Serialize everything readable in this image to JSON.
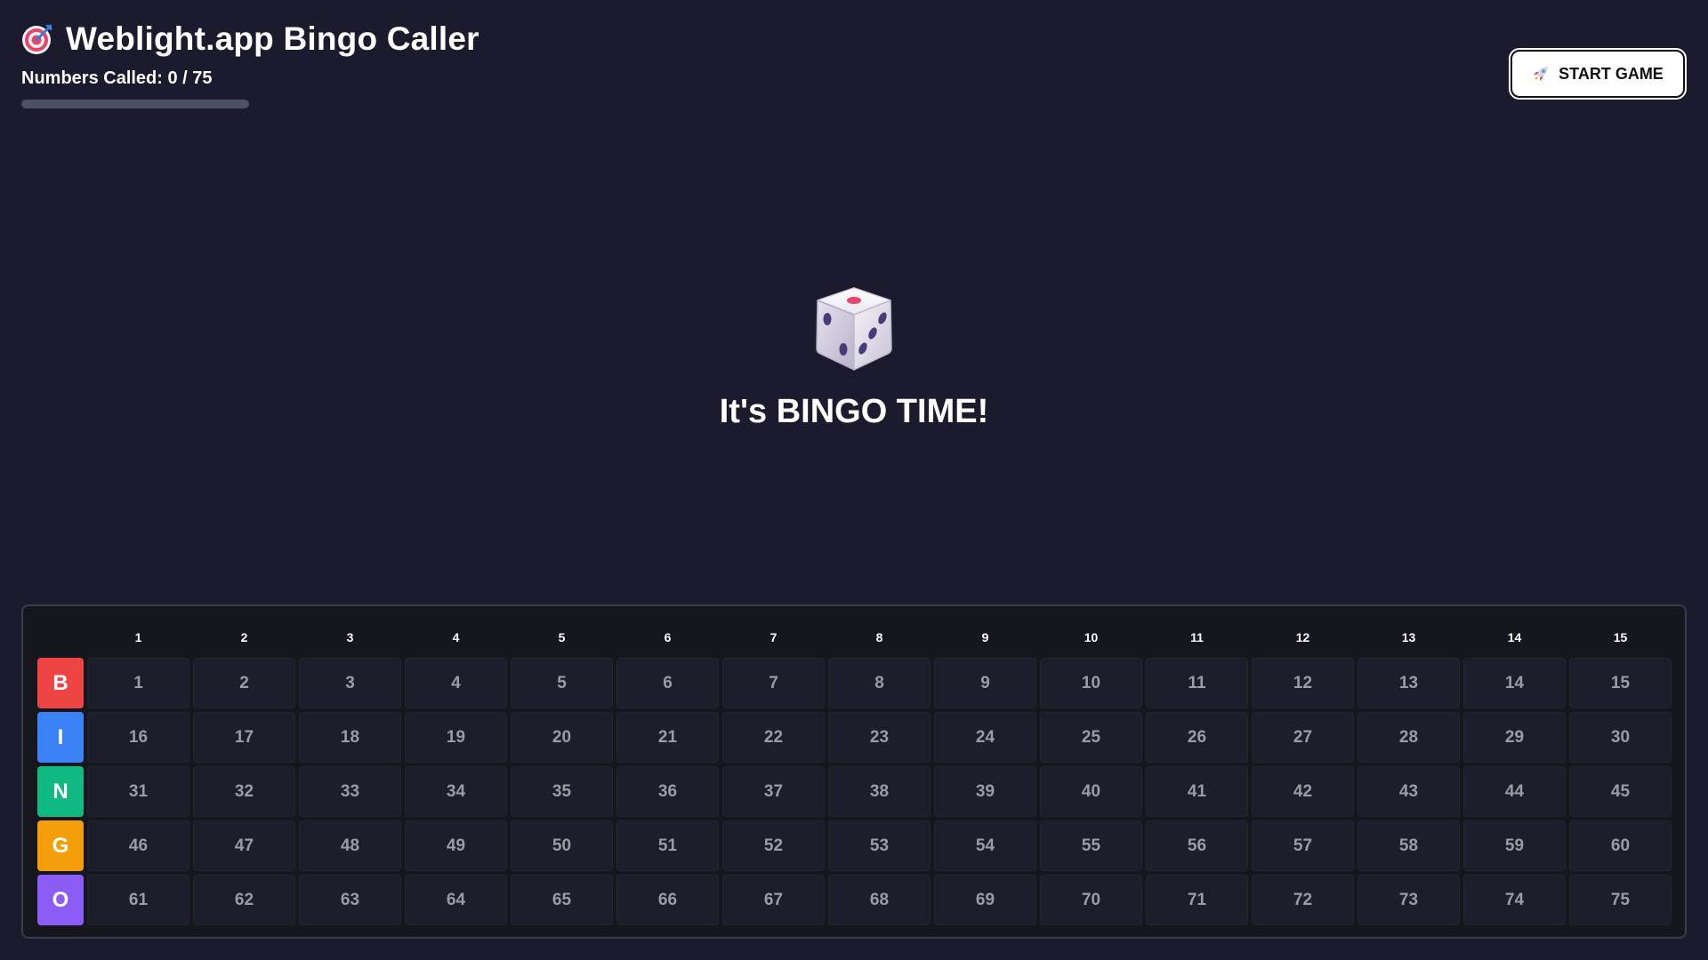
{
  "app": {
    "title": "Weblight.app Bingo Caller",
    "counter_label": "Numbers Called: 0 / 75",
    "called_count": 0,
    "total_numbers": 75
  },
  "toolbar": {
    "start_label": "START GAME",
    "start_icon": "rocket-icon"
  },
  "center": {
    "icon": "dice-icon",
    "message": "It's BINGO TIME!"
  },
  "board": {
    "column_headers": [
      "1",
      "2",
      "3",
      "4",
      "5",
      "6",
      "7",
      "8",
      "9",
      "10",
      "11",
      "12",
      "13",
      "14",
      "15"
    ],
    "rows": [
      {
        "letter": "B",
        "color": "#ee4444",
        "numbers": [
          "1",
          "2",
          "3",
          "4",
          "5",
          "6",
          "7",
          "8",
          "9",
          "10",
          "11",
          "12",
          "13",
          "14",
          "15"
        ]
      },
      {
        "letter": "I",
        "color": "#3b82f6",
        "numbers": [
          "16",
          "17",
          "18",
          "19",
          "20",
          "21",
          "22",
          "23",
          "24",
          "25",
          "26",
          "27",
          "28",
          "29",
          "30"
        ]
      },
      {
        "letter": "N",
        "color": "#10b981",
        "numbers": [
          "31",
          "32",
          "33",
          "34",
          "35",
          "36",
          "37",
          "38",
          "39",
          "40",
          "41",
          "42",
          "43",
          "44",
          "45"
        ]
      },
      {
        "letter": "G",
        "color": "#f59e0b",
        "numbers": [
          "46",
          "47",
          "48",
          "49",
          "50",
          "51",
          "52",
          "53",
          "54",
          "55",
          "56",
          "57",
          "58",
          "59",
          "60"
        ]
      },
      {
        "letter": "O",
        "color": "#8b5cf6",
        "numbers": [
          "61",
          "62",
          "63",
          "64",
          "65",
          "66",
          "67",
          "68",
          "69",
          "70",
          "71",
          "72",
          "73",
          "74",
          "75"
        ]
      }
    ]
  },
  "colors": {
    "background": "#1b1b2d",
    "board_background": "#16161f",
    "cell_background": "#1d1e2b",
    "progress_fill": "#6a8bff"
  }
}
